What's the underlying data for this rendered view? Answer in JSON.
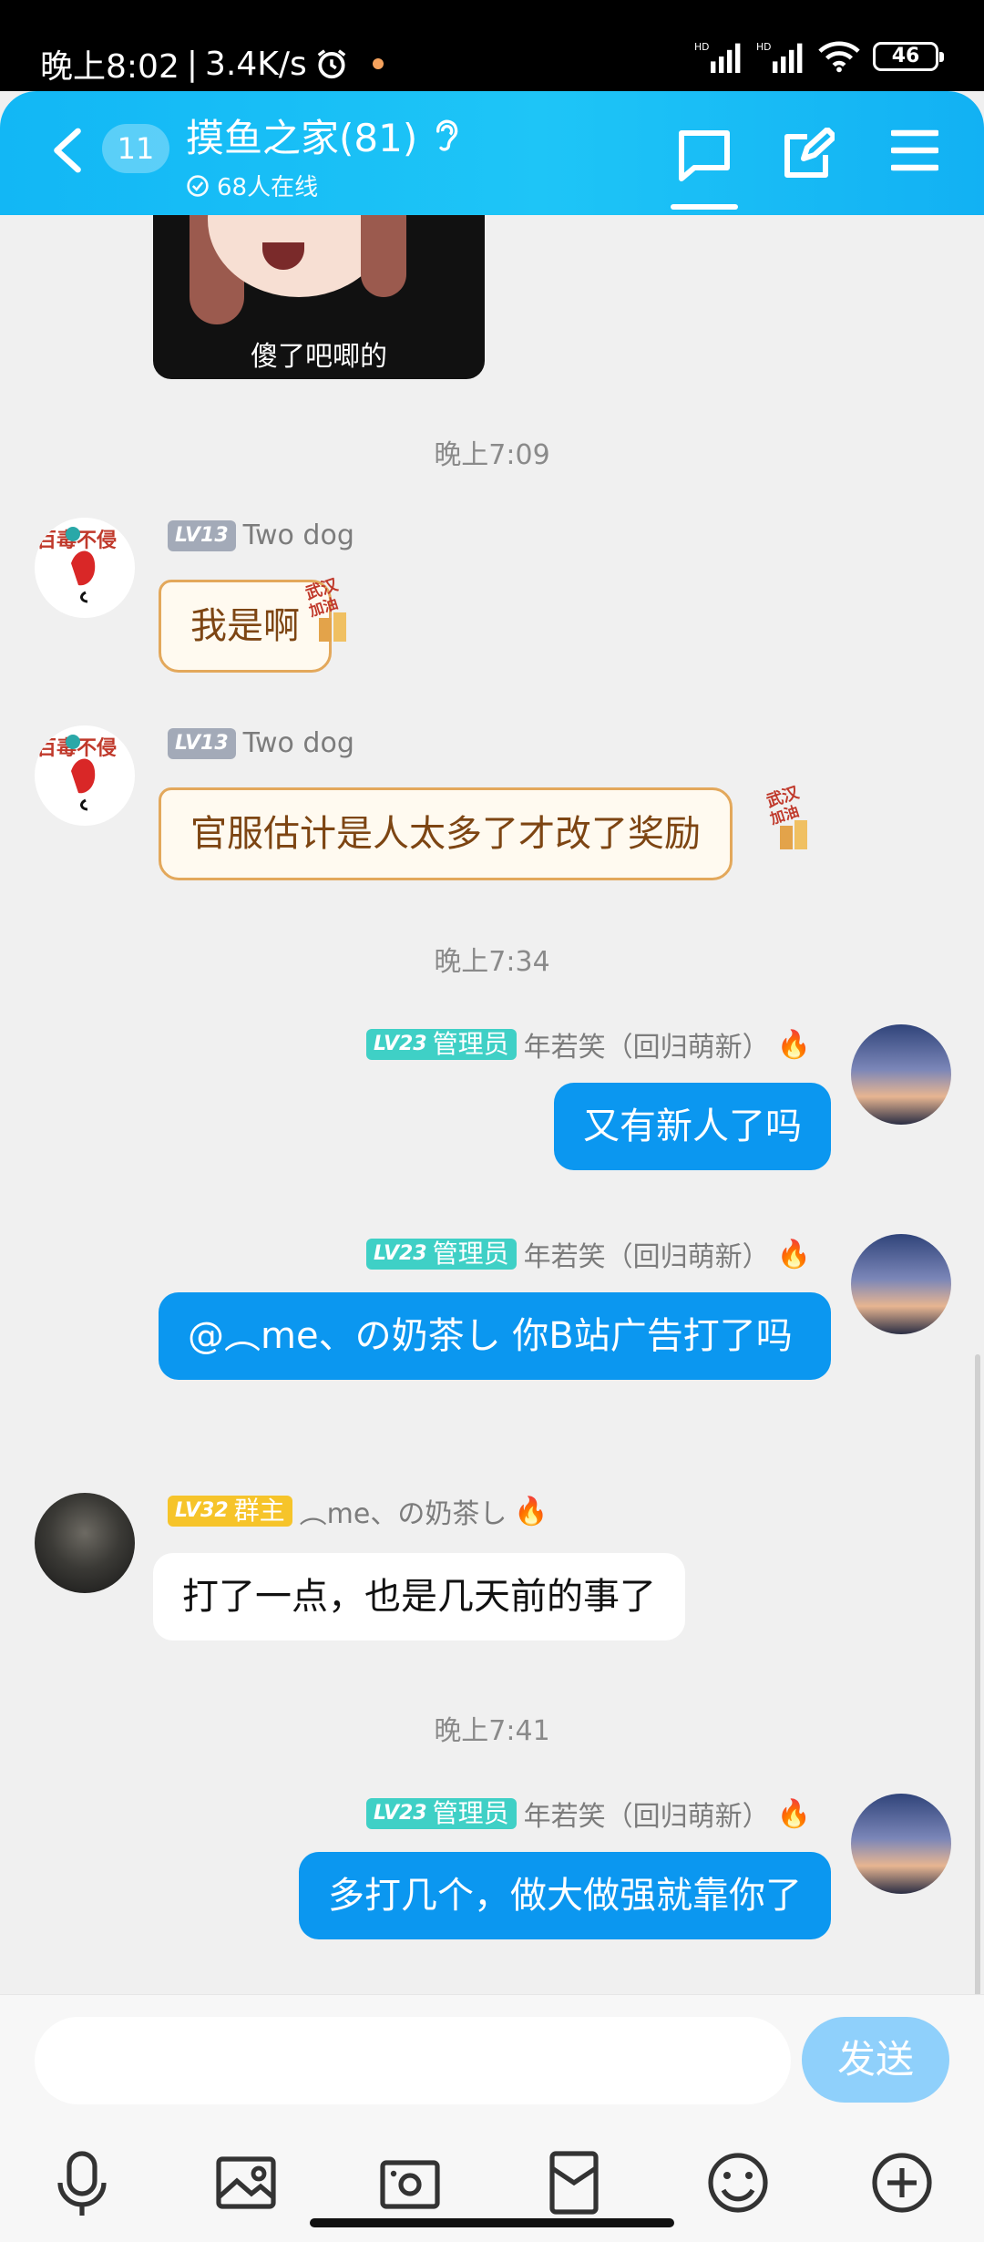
{
  "status_bar": {
    "time": "晚上8:02",
    "speed": "3.4K/s",
    "battery": "46"
  },
  "header": {
    "unread_count": "11",
    "group_name": "摸鱼之家(81)",
    "online": "68人在线"
  },
  "sticker": {
    "caption": "傻了吧唧的"
  },
  "messages": [
    {
      "type": "time",
      "text": "晚上7:09"
    },
    {
      "type": "msg",
      "level": "LV13",
      "name": "Two dog",
      "text": "我是啊"
    },
    {
      "type": "msg",
      "level": "LV13",
      "name": "Two dog",
      "text": "官服估计是人太多了才改了奖励"
    },
    {
      "type": "time",
      "text": "晚上7:34"
    },
    {
      "type": "msg",
      "level": "LV23",
      "role": "管理员",
      "name": "年若笑（回归萌新）",
      "text": "又有新人了吗"
    },
    {
      "type": "msg",
      "level": "LV23",
      "role": "管理员",
      "name": "年若笑（回归萌新）",
      "text": "@︵me、の奶茶し 你B站广告打了吗"
    },
    {
      "type": "msg",
      "level": "LV32",
      "role": "群主",
      "name": "︵me、の奶茶し",
      "text": "打了一点，也是几天前的事了"
    },
    {
      "type": "time",
      "text": "晚上7:41"
    },
    {
      "type": "msg",
      "level": "LV23",
      "role": "管理员",
      "name": "年若笑（回归萌新）",
      "text": "多打几个，做大做强就靠你了"
    }
  ],
  "input": {
    "send_label": "发送"
  },
  "colors": {
    "header": "#12b7f5",
    "bubble_self": "#0b97f0",
    "send_disabled": "#8fd0fb"
  }
}
